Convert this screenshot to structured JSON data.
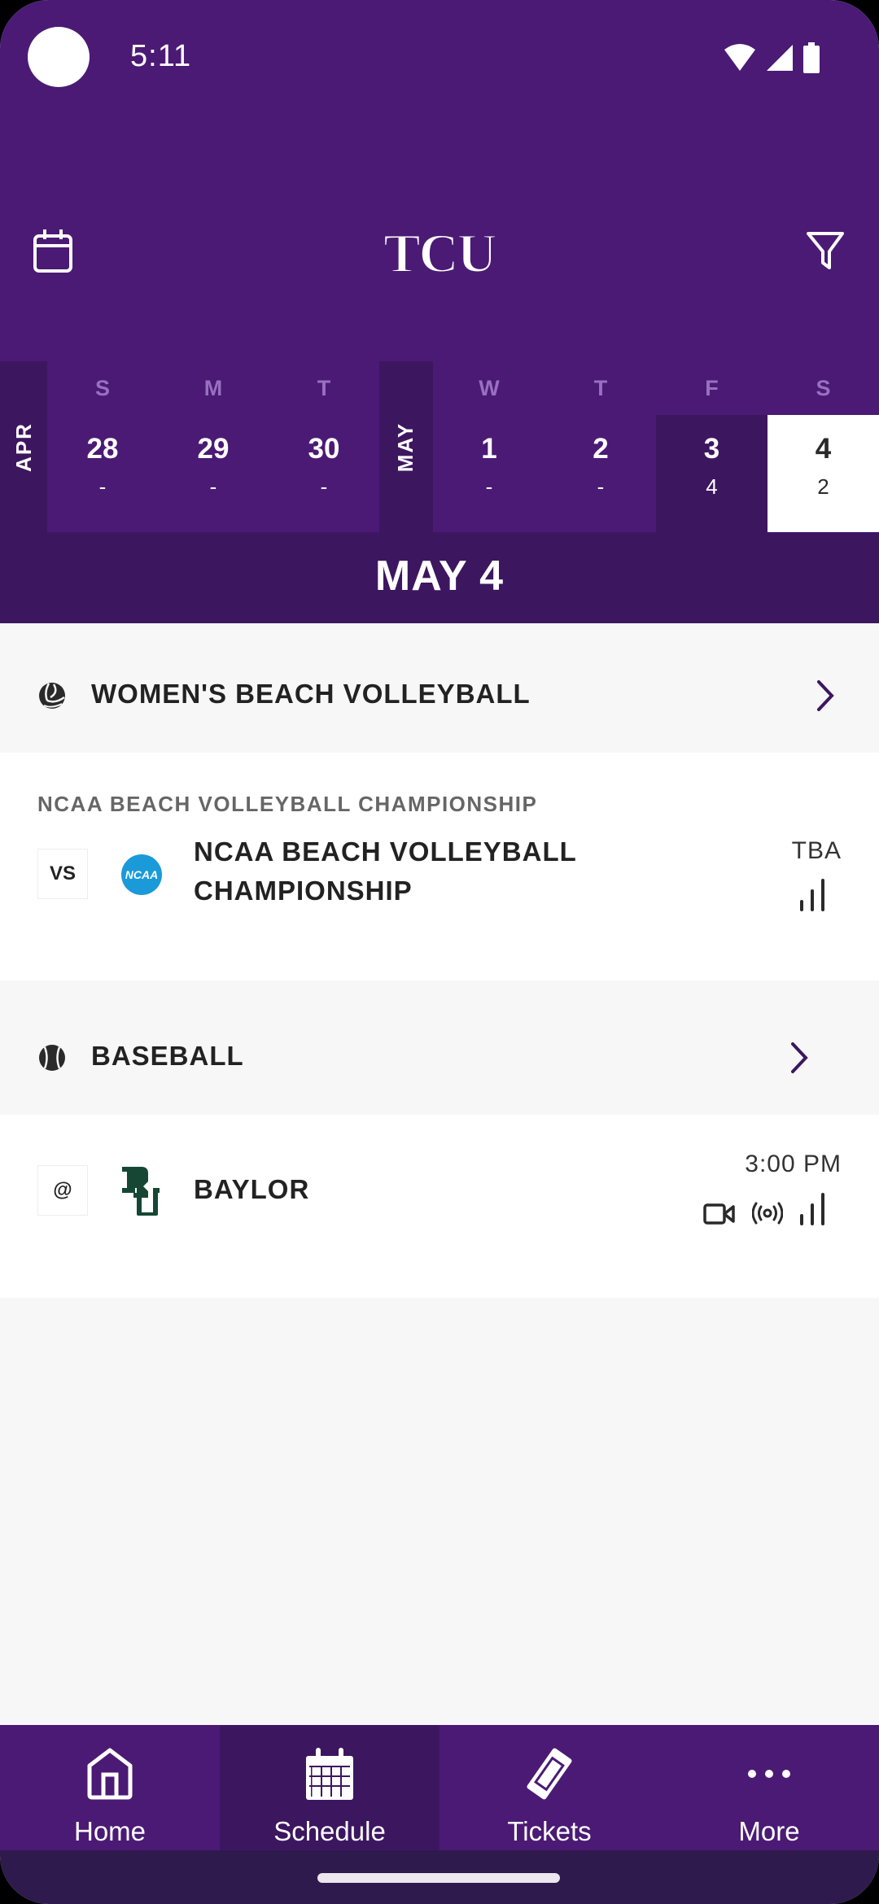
{
  "status_bar": {
    "time": "5:11",
    "icons": [
      "wifi-icon",
      "cell-signal-icon",
      "battery-icon"
    ]
  },
  "header": {
    "left_icon": "calendar-icon",
    "logo_text": "TCU",
    "right_icon": "filter-icon"
  },
  "calendar": {
    "months": [
      {
        "label": "APR"
      },
      {
        "label": "MAY"
      }
    ],
    "days": [
      {
        "dow": "S",
        "day": "28",
        "count": "-",
        "month": "APR",
        "state": "normal"
      },
      {
        "dow": "M",
        "day": "29",
        "count": "-",
        "month": "APR",
        "state": "normal"
      },
      {
        "dow": "T",
        "day": "30",
        "count": "-",
        "month": "APR",
        "state": "normal"
      },
      {
        "dow": "W",
        "day": "1",
        "count": "-",
        "month": "MAY",
        "state": "normal"
      },
      {
        "dow": "T",
        "day": "2",
        "count": "-",
        "month": "MAY",
        "state": "normal"
      },
      {
        "dow": "F",
        "day": "3",
        "count": "4",
        "month": "MAY",
        "state": "has-events"
      },
      {
        "dow": "S",
        "day": "4",
        "count": "2",
        "month": "MAY",
        "state": "selected"
      }
    ],
    "selected_date": "MAY 4"
  },
  "sections": [
    {
      "sport": "WOMEN'S BEACH VOLLEYBALL",
      "icon": "volleyball-icon",
      "games": [
        {
          "event_label": "NCAA BEACH VOLLEYBALL CHAMPIONSHIP",
          "home_away": "VS",
          "opponent_logo": "ncaa-logo",
          "opponent_logo_text": "NCAA",
          "opponent_line1": "NCAA BEACH VOLLEYBALL",
          "opponent_line2": "CHAMPIONSHIP",
          "time": "TBA",
          "media": [
            "stats-icon"
          ]
        }
      ]
    },
    {
      "sport": "BASEBALL",
      "icon": "baseball-icon",
      "games": [
        {
          "home_away": "@",
          "opponent_logo": "baylor-logo",
          "opponent": "BAYLOR",
          "time": "3:00 PM",
          "media": [
            "video-icon",
            "radio-broadcast-icon",
            "stats-icon"
          ]
        }
      ]
    }
  ],
  "bottom_nav": {
    "items": [
      {
        "label": "Home",
        "icon": "home-icon",
        "active": false
      },
      {
        "label": "Schedule",
        "icon": "calendar-grid-icon",
        "active": true
      },
      {
        "label": "Tickets",
        "icon": "ticket-icon",
        "active": false
      },
      {
        "label": "More",
        "icon": "more-dots-icon",
        "active": false
      }
    ]
  },
  "colors": {
    "primary_purple": "#4b1a75",
    "dark_purple": "#3d1660",
    "accent_chevron": "#3d1660",
    "ncaa_blue": "#1a9ad9",
    "baylor_green": "#154734"
  }
}
